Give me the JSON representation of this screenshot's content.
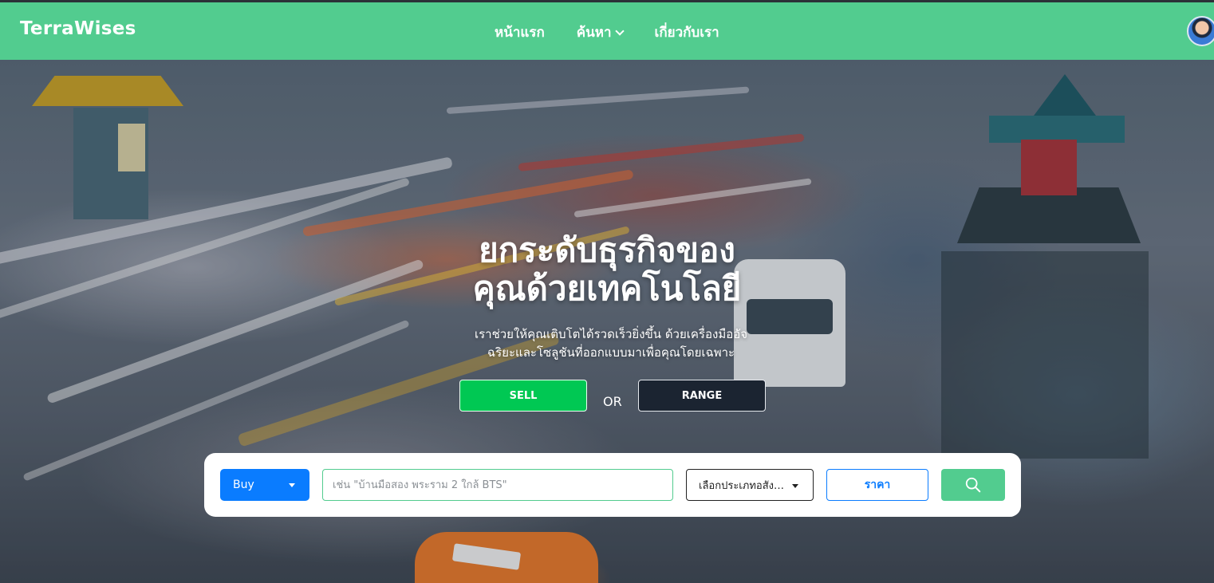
{
  "brand": "TerraWises",
  "nav": {
    "items": [
      {
        "label": "หน้าแรก"
      },
      {
        "label": "ค้นหา",
        "icon": "chevron-down-icon"
      },
      {
        "label": "เกี่ยวกับเรา"
      }
    ]
  },
  "hero": {
    "headline_line1": "ยกระดับธุรกิจของ",
    "headline_line2": "คุณด้วยเทคโนโลยี",
    "subline_line1": "เราช่วยให้คุณเติบโตได้รวดเร็วยิ่งขึ้น ด้วยเครื่องมืออัจ",
    "subline_line2": "ฉริยะและโซลูชันที่ออกแบบมาเพื่อคุณโดยเฉพาะ",
    "sell_label": "SELL",
    "or_label": "OR",
    "range_label": "RANGE"
  },
  "search": {
    "mode_value": "Buy",
    "placeholder": "เช่น \"บ้านมือสอง พระราม 2 ใกล้ BTS\"",
    "type_value": "เลือกประเภทอสังหาริมทรัพย์",
    "price_label": "ราคา",
    "submit_icon": "search-icon"
  },
  "colors": {
    "navbar": "#52cc8f",
    "sell": "#00c853",
    "range": "#1b2431",
    "primary_blue": "#0a7cff"
  }
}
